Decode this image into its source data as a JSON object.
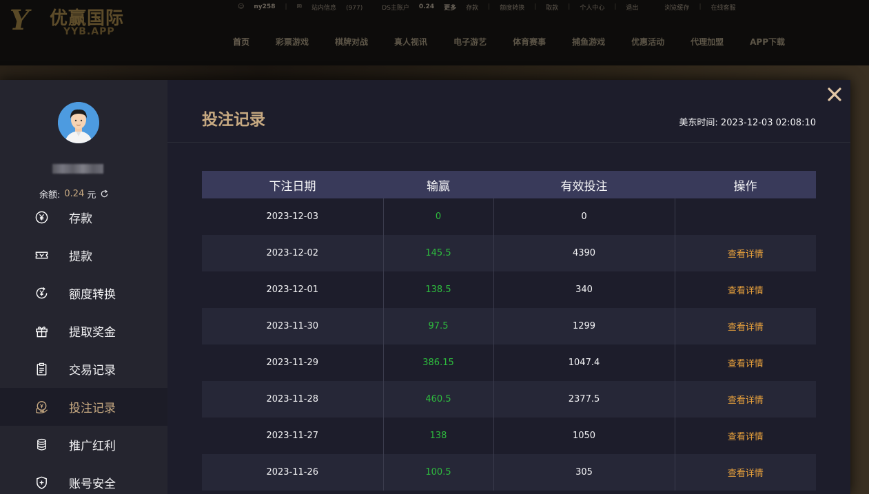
{
  "site": {
    "logo_text": "优赢国际",
    "logo_sub": "YYB.APP",
    "topbar": {
      "username": "ny258",
      "messages_label": "站内信息",
      "messages_count": "(977)",
      "account_type": "DS主账户",
      "balance": "0.24",
      "more": "更多",
      "links": [
        "存款",
        "额度转换",
        "取款",
        "个人中心",
        "退出"
      ],
      "right_links": [
        "浏览缓存",
        "在线客服"
      ]
    },
    "nav": [
      "首页",
      "彩票游戏",
      "棋牌对战",
      "真人视讯",
      "电子游艺",
      "体育赛事",
      "捕鱼游戏",
      "优惠活动",
      "代理加盟",
      "APP下载"
    ]
  },
  "sidebar": {
    "balance_label": "余额:",
    "balance_value": "0.24",
    "balance_unit": "元",
    "items": [
      {
        "label": "存款",
        "icon": "yen-circle-icon"
      },
      {
        "label": "提款",
        "icon": "ticket-icon"
      },
      {
        "label": "额度转换",
        "icon": "transfer-icon"
      },
      {
        "label": "提取奖金",
        "icon": "gift-icon"
      },
      {
        "label": "交易记录",
        "icon": "clipboard-icon"
      },
      {
        "label": "投注记录",
        "icon": "bet-record-icon",
        "active": true
      },
      {
        "label": "推广红利",
        "icon": "coins-icon"
      },
      {
        "label": "账号安全",
        "icon": "shield-icon"
      }
    ]
  },
  "main": {
    "title": "投注记录",
    "clock_label": "美东时间:",
    "clock_value": "2023-12-03 02:08:10",
    "table": {
      "headers": [
        "下注日期",
        "输赢",
        "有效投注",
        "操作"
      ],
      "rows": [
        {
          "date": "2023-12-03",
          "winloss": "0",
          "valid": "0",
          "action": ""
        },
        {
          "date": "2023-12-02",
          "winloss": "145.5",
          "valid": "4390",
          "action": "查看详情"
        },
        {
          "date": "2023-12-01",
          "winloss": "138.5",
          "valid": "340",
          "action": "查看详情"
        },
        {
          "date": "2023-11-30",
          "winloss": "97.5",
          "valid": "1299",
          "action": "查看详情"
        },
        {
          "date": "2023-11-29",
          "winloss": "386.15",
          "valid": "1047.4",
          "action": "查看详情"
        },
        {
          "date": "2023-11-28",
          "winloss": "460.5",
          "valid": "2377.5",
          "action": "查看详情"
        },
        {
          "date": "2023-11-27",
          "winloss": "138",
          "valid": "1050",
          "action": "查看详情"
        },
        {
          "date": "2023-11-26",
          "winloss": "100.5",
          "valid": "305",
          "action": "查看详情"
        }
      ]
    }
  },
  "colors": {
    "accent_gold": "#c8aa82",
    "win_green": "#2ebd3e",
    "link_orange": "#e8a13c",
    "header_row": "#393a5a"
  }
}
